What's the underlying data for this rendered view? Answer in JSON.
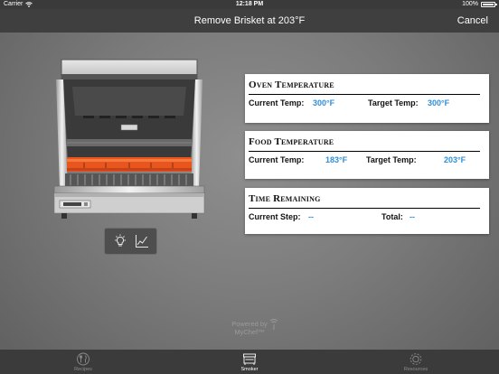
{
  "status_bar": {
    "carrier": "Carrier",
    "time": "12:18 PM",
    "battery": "100%"
  },
  "nav": {
    "title": "Remove Brisket at 203°F",
    "cancel": "Cancel"
  },
  "oven": {
    "title": "Oven Temperature",
    "current_label": "Current Temp:",
    "current_value": "300°F",
    "target_label": "Target Temp:",
    "target_value": "300°F"
  },
  "food": {
    "title": "Food Temperature",
    "current_label": "Current Temp:",
    "current_value": "183°F",
    "target_label": "Target Temp:",
    "target_value": "203°F"
  },
  "time": {
    "title": "Time Remaining",
    "step_label": "Current Step:",
    "step_value": "--",
    "total_label": "Total:",
    "total_value": "--"
  },
  "powered": {
    "line1": "Powered by",
    "line2": "MyChef™"
  },
  "tabs": [
    {
      "label": "Recipes",
      "icon": "fork-knife-icon",
      "active": false
    },
    {
      "label": "Smoker",
      "icon": "smoker-icon",
      "active": true
    },
    {
      "label": "Resources",
      "icon": "gear-icon",
      "active": false
    }
  ],
  "colors": {
    "accent_blue": "#2f8fd8",
    "bar": "#3f3f3f",
    "heating_element": "#e8561e"
  }
}
